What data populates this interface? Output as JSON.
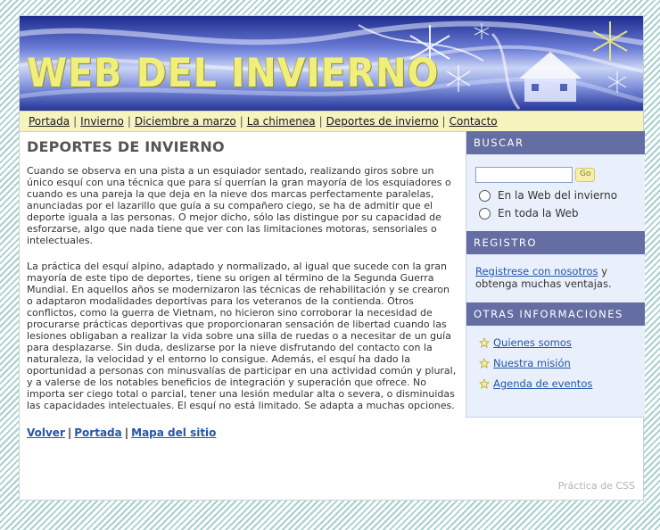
{
  "banner": {
    "title": "WEB DEL INVIERNO"
  },
  "nav": {
    "items": [
      "Portada",
      "Invierno",
      "Diciembre a marzo",
      "La chimenea",
      "Deportes de invierno",
      "Contacto"
    ]
  },
  "main": {
    "heading": "DEPORTES DE INVIERNO",
    "paragraphs": [
      "Cuando se observa en una pista a un esquiador sentado, realizando giros sobre un único esquí con una técnica que para sí querrían la gran mayoría de los esquiadores o cuando es una pareja la que deja en la nieve dos marcas perfectamente paralelas, anunciadas por el lazarillo que guía a su compañero ciego, se ha de admitir que el deporte iguala a las personas. O mejor dicho, sólo las distingue por su capacidad de esforzarse, algo que nada tiene que ver con las limitaciones motoras, sensoriales o intelectuales.",
      "La práctica del esquí alpino, adaptado y normalizado, al igual que sucede con la gran mayoría de este tipo de deportes, tiene su origen al término de la Segunda Guerra Mundial. En aquellos años se modernizaron las técnicas de rehabilitación y se crearon o adaptaron modalidades deportivas para los veteranos de la contienda. Otros conflictos, como la guerra de Vietnam, no hicieron sino corroborar la necesidad de procurarse prácticas deportivas que proporcionaran sensación de libertad cuando las lesiones obligaban a realizar la vida sobre una silla de ruedas o a necesitar de un guía para desplazarse. Sin duda, deslizarse por la nieve disfrutando del contacto con la naturaleza, la velocidad y el entorno lo consigue. Además, el esquí ha dado la oportunidad a personas con minusvalías de participar en una actividad común y plural, y a valerse de los notables beneficios de integración y superación que ofrece. No importa ser ciego total o parcial, tener una lesión medular alta o severa, o disminuidas las capacidades intelectuales. El esquí no está limitado. Se adapta a muchas opciones."
    ],
    "bottom_links": [
      "Volver",
      "Portada",
      "Mapa del sitio"
    ]
  },
  "sidebar": {
    "search": {
      "heading": "BUSCAR",
      "input_value": "",
      "go_label": "Go",
      "options": [
        "En la Web del invierno",
        "En toda la Web"
      ]
    },
    "registro": {
      "heading": "REGISTRO",
      "link_text": "Registrese con nosotros",
      "rest_text": " y obtenga muchas ventajas."
    },
    "otras": {
      "heading": "OTRAS INFORMACIONES",
      "items": [
        "Quienes somos",
        "Nuestra misión",
        "Agenda de eventos"
      ]
    }
  },
  "footer": {
    "note": "Práctica de CSS"
  },
  "colors": {
    "sidebar_header": "#646ea3",
    "nav_background": "#f6f3bf",
    "link": "#2255aa",
    "banner_text": "#f1ef7c"
  }
}
